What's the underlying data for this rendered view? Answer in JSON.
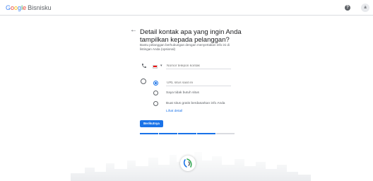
{
  "header": {
    "logo_google": [
      "G",
      "o",
      "o",
      "g",
      "l",
      "e"
    ],
    "logo_product": "Bisnisku",
    "help_glyph": "?",
    "avatar_initial": "a"
  },
  "page": {
    "title": "Detail kontak apa yang ingin Anda tampilkan kepada pelanggan?",
    "subtitle": "Bantu pelanggan berhubungan dengan menyertakan info ini di listingan Anda (opsional)",
    "back_glyph": "←"
  },
  "phone": {
    "placeholder": "Nomor telepon kontak",
    "country": "Indonesia",
    "caret": "▾"
  },
  "website": {
    "options": [
      {
        "label": "URL situs saat ini",
        "selected": true,
        "is_input": true
      },
      {
        "label": "Saya tidak butuh situs",
        "selected": false
      },
      {
        "label": "Buat situs gratis berdasarkan info Anda",
        "selected": false
      }
    ],
    "link": "Lihat detail"
  },
  "actions": {
    "next_label": "Berikutnya"
  },
  "progress": {
    "steps_total": 5,
    "steps_done": 4
  },
  "colors": {
    "accent": "#1a73e8"
  }
}
